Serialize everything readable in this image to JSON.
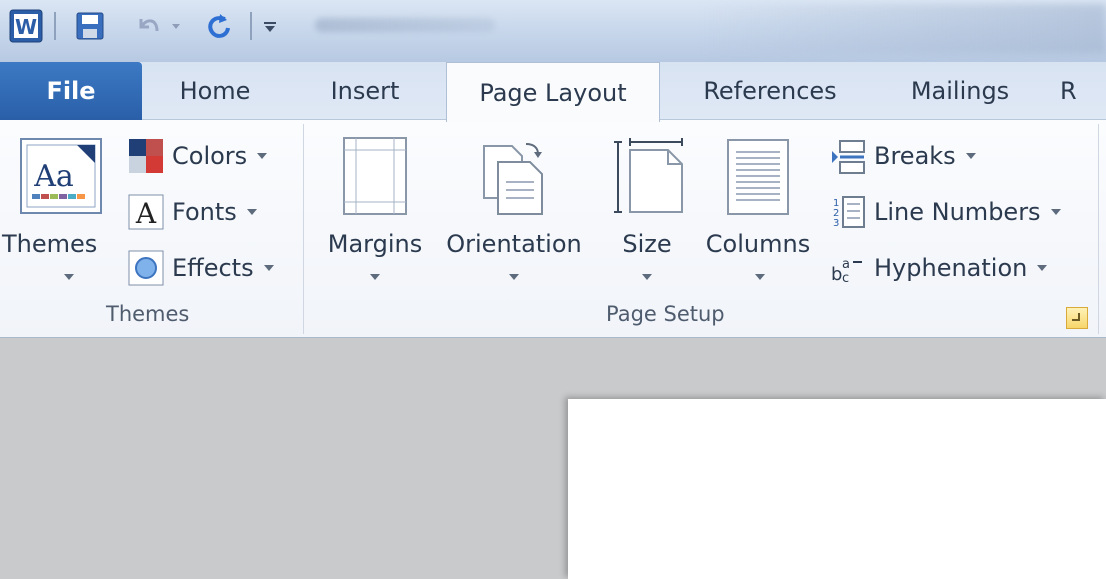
{
  "app": {
    "name": "Microsoft Word",
    "accent": "#2a5fa8"
  },
  "qat": {
    "icons": [
      "word-app-icon",
      "save-icon",
      "undo-icon",
      "redo-icon",
      "customize-qat-icon"
    ]
  },
  "tabs": [
    {
      "label": "File"
    },
    {
      "label": "Home"
    },
    {
      "label": "Insert"
    },
    {
      "label": "Page Layout",
      "active": true
    },
    {
      "label": "References"
    },
    {
      "label": "Mailings"
    },
    {
      "label": "R"
    }
  ],
  "ribbon": {
    "themes_group": {
      "label": "Themes",
      "themes_button": "Themes",
      "colors": "Colors",
      "fonts": "Fonts",
      "effects": "Effects"
    },
    "page_setup_group": {
      "label": "Page Setup",
      "margins": "Margins",
      "orientation": "Orientation",
      "size": "Size",
      "columns": "Columns",
      "breaks": "Breaks",
      "line_numbers": "Line Numbers",
      "hyphenation": "Hyphenation"
    }
  }
}
